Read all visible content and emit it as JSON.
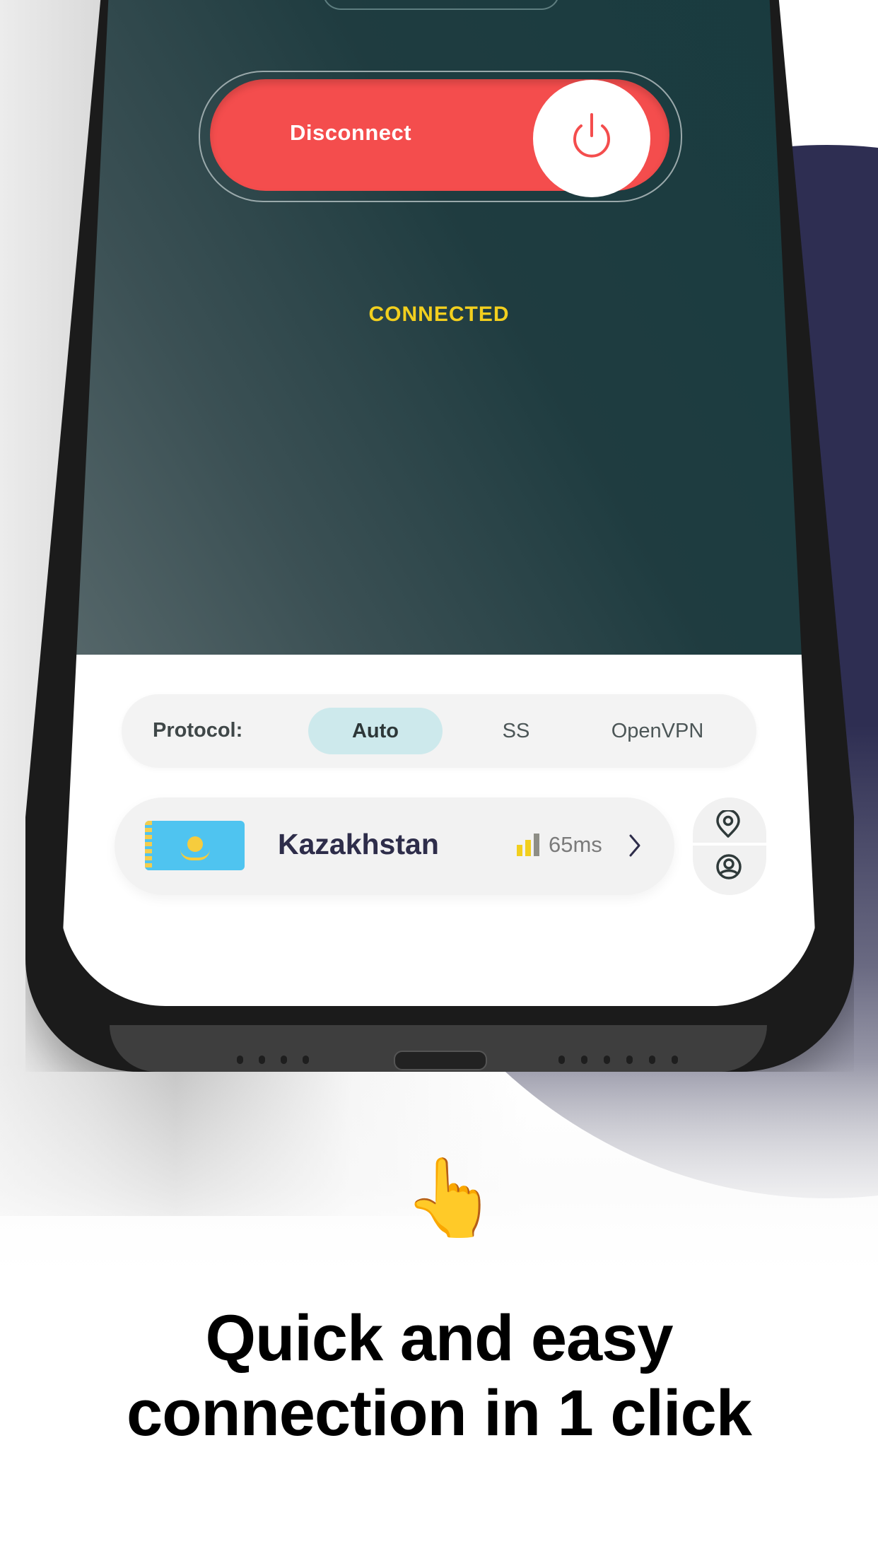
{
  "connect_button": {
    "label": "Disconnect",
    "icon": "power-icon"
  },
  "status": {
    "text": "CONNECTED",
    "color": "#f2cf1e"
  },
  "protocol": {
    "label": "Protocol:",
    "options": [
      {
        "label": "Auto",
        "selected": true
      },
      {
        "label": "SS",
        "selected": false
      },
      {
        "label": "OpenVPN",
        "selected": false
      }
    ]
  },
  "server": {
    "country": "Kazakhstan",
    "flag": "kazakhstan-flag",
    "ping": "65ms",
    "signal_bars_active": 2,
    "signal_bars_total": 3
  },
  "side_actions": [
    {
      "icon": "location-pin-icon"
    },
    {
      "icon": "user-circle-icon"
    }
  ],
  "promo": {
    "emoji": "👆",
    "headline_line1": "Quick and easy",
    "headline_line2": "connection in 1 click"
  },
  "colors": {
    "accent_red": "#f44d4d",
    "screen_dark": "#183b3f",
    "selected_chip": "#cde9ec",
    "country_text": "#2e2d4a",
    "background_blob": "#2e2e52"
  }
}
